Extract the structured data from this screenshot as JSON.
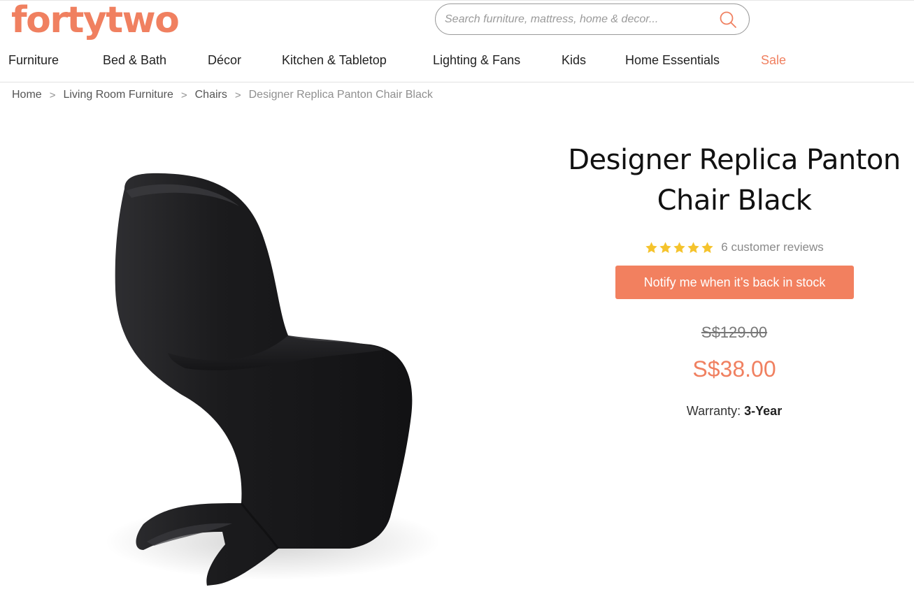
{
  "header": {
    "logo": "fortytwo",
    "search": {
      "placeholder": "Search furniture, mattress, home & decor..."
    }
  },
  "nav": {
    "items": [
      {
        "label": "Furniture"
      },
      {
        "label": "Bed & Bath"
      },
      {
        "label": "Décor"
      },
      {
        "label": "Kitchen & Tabletop"
      },
      {
        "label": "Lighting & Fans"
      },
      {
        "label": "Kids"
      },
      {
        "label": "Home Essentials"
      },
      {
        "label": "Sale"
      }
    ]
  },
  "breadcrumb": {
    "separator": ">",
    "items": [
      {
        "label": "Home"
      },
      {
        "label": "Living Room Furniture"
      },
      {
        "label": "Chairs"
      },
      {
        "label": "Designer Replica Panton Chair Black"
      }
    ]
  },
  "product": {
    "title_line1": "Designer Replica Panton",
    "title_line2": "Chair Black",
    "rating": 5,
    "reviews_text": "6 customer reviews",
    "notify_label": "Notify me when it’s back in stock",
    "old_price": "S$129.00",
    "new_price": "S$38.00",
    "warranty_label": "Warranty:",
    "warranty_value": "3-Year"
  },
  "colors": {
    "accent": "#f08060",
    "star": "#f5c32c",
    "chair": "#1e1e20"
  },
  "icons": {
    "search": "search-icon",
    "star": "star-icon"
  }
}
